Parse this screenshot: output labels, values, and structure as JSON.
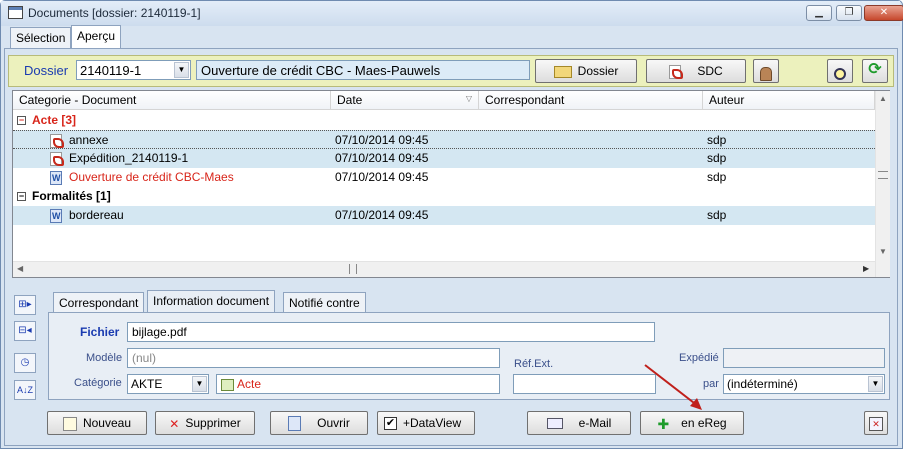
{
  "window": {
    "title": "Documents  [dossier: 2140119-1]",
    "minimize_label": "▁",
    "restore_label": "❐",
    "close_label": "✕"
  },
  "top_tabs": [
    {
      "label": "Sélection"
    },
    {
      "label": "Aperçu"
    }
  ],
  "dossier_bar": {
    "label": "Dossier",
    "dossier_value": "2140119-1",
    "description": "Ouverture de crédit CBC - Maes-Pauwels",
    "dossier_button": "Dossier",
    "sdc_button": "SDC"
  },
  "grid": {
    "columns": [
      "Categorie - Document",
      "Date",
      "Correspondant",
      "Auteur"
    ],
    "groups": [
      {
        "label": "Acte [3]",
        "color": "#d8251a",
        "items": [
          {
            "name": "annexe",
            "date": "07/10/2014 09:45",
            "author": "sdp",
            "icon": "pdf-icon",
            "red": false,
            "selected": true
          },
          {
            "name": "Expédition_2140119-1",
            "date": "07/10/2014 09:45",
            "author": "sdp",
            "icon": "pdf-icon",
            "red": false,
            "selected": true
          },
          {
            "name": "Ouverture de crédit CBC-Maes",
            "date": "07/10/2014 09:45",
            "author": "sdp",
            "icon": "word-doc-icon",
            "red": true,
            "selected": false
          }
        ]
      },
      {
        "label": "Formalités [1]",
        "color": "#000000",
        "items": [
          {
            "name": "bordereau",
            "date": "07/10/2014 09:45",
            "author": "sdp",
            "icon": "word-doc-icon",
            "red": false,
            "selected": true
          }
        ]
      }
    ]
  },
  "panel_tabs": [
    {
      "label": "Correspondant"
    },
    {
      "label": "Information document"
    },
    {
      "label": "Notifié contre"
    }
  ],
  "info": {
    "fichier_label": "Fichier",
    "fichier_value": "bijlage.pdf",
    "modele_label": "Modèle",
    "modele_value": "(nul)",
    "categorie_label": "Catégorie",
    "categorie_value": "AKTE",
    "categorie_tag": "Acte",
    "ref_label": "Réf.Ext.",
    "ref_value": "",
    "expedie_label": "Expédié",
    "expedie_value": "",
    "par_label": "par",
    "par_value": "(indéterminé)"
  },
  "bottom": {
    "nouveau": "Nouveau",
    "supprimer": "Supprimer",
    "ouvrir": "Ouvrir",
    "dataview": "+DataView",
    "dataview_checked": true,
    "email": "e-Mail",
    "ereg": "en eReg"
  },
  "colors": {
    "accent": "#1a3bb0",
    "selected_row": "#d4e7f2",
    "dossier_bar": "#ecf1bd",
    "annotation_arrow": "#c0201b"
  }
}
